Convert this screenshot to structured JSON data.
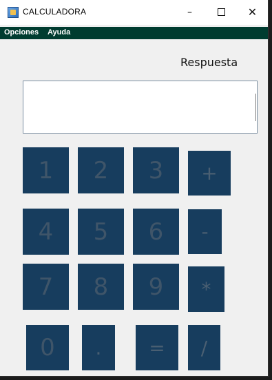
{
  "window": {
    "title": "CALCULADORA",
    "controls": {
      "minimize": "–",
      "close": "✕"
    }
  },
  "menu": {
    "items": [
      "Opciones",
      "Ayuda"
    ]
  },
  "display": {
    "label": "Respuesta",
    "value": ""
  },
  "keys": {
    "one": "1",
    "two": "2",
    "three": "3",
    "plus": "+",
    "four": "4",
    "five": "5",
    "six": "6",
    "minus": "-",
    "seven": "7",
    "eight": "8",
    "nine": "9",
    "multiply": "*",
    "zero": "0",
    "dot": ".",
    "equals": "=",
    "divide": "/"
  },
  "colors": {
    "menubar": "#003c30",
    "key_background": "#173d5e",
    "key_text": "#3f5569",
    "window_background": "#f0f0f0"
  }
}
